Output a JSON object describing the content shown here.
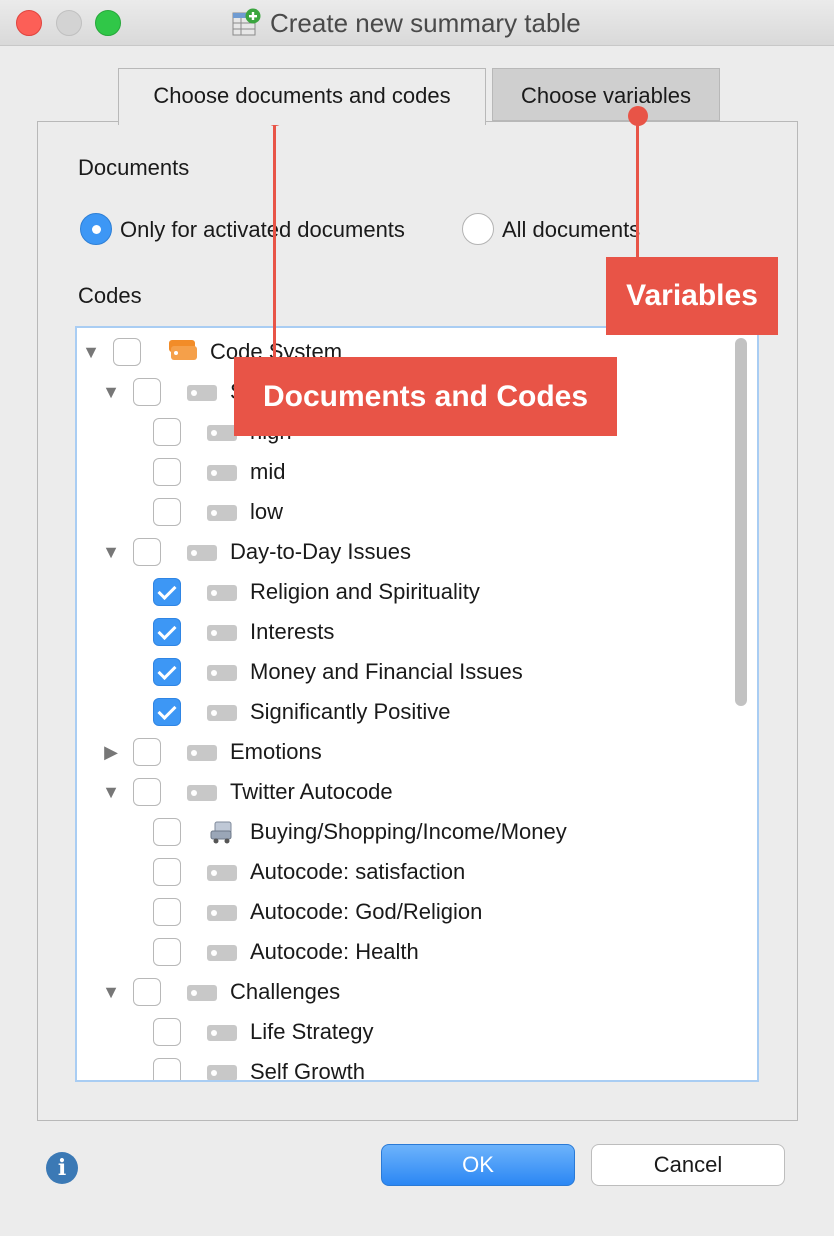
{
  "window": {
    "title": "Create new summary table"
  },
  "tabs": [
    {
      "label": "Choose documents and codes",
      "active": true
    },
    {
      "label": "Choose variables",
      "active": false
    }
  ],
  "documents": {
    "heading": "Documents",
    "options": [
      {
        "label": "Only for activated documents",
        "selected": true
      },
      {
        "label": "All documents",
        "selected": false
      }
    ]
  },
  "codes": {
    "heading": "Codes",
    "tree": [
      {
        "label": "Code System",
        "expanded": true,
        "checked": false,
        "icon": "code-system-icon"
      },
      {
        "label": "S",
        "expanded": true,
        "checked": false,
        "icon": "code-tag-icon"
      },
      {
        "label": "high",
        "checked": false,
        "icon": "code-tag-icon"
      },
      {
        "label": "mid",
        "checked": false,
        "icon": "code-tag-icon"
      },
      {
        "label": "low",
        "checked": false,
        "icon": "code-tag-icon"
      },
      {
        "label": "Day-to-Day Issues",
        "expanded": true,
        "checked": false,
        "icon": "code-tag-icon"
      },
      {
        "label": "Religion and Spirituality",
        "checked": true,
        "icon": "code-tag-icon"
      },
      {
        "label": "Interests",
        "checked": true,
        "icon": "code-tag-icon"
      },
      {
        "label": "Money and Financial Issues",
        "checked": true,
        "icon": "code-tag-icon"
      },
      {
        "label": "Significantly Positive",
        "checked": true,
        "icon": "code-tag-icon"
      },
      {
        "label": "Emotions",
        "expanded": false,
        "checked": false,
        "icon": "code-tag-icon"
      },
      {
        "label": "Twitter Autocode",
        "expanded": true,
        "checked": false,
        "icon": "code-tag-icon"
      },
      {
        "label": "Buying/Shopping/Income/Money",
        "checked": false,
        "icon": "shopping-cart-icon"
      },
      {
        "label": "Autocode: satisfaction",
        "checked": false,
        "icon": "code-tag-icon"
      },
      {
        "label": "Autocode: God/Religion",
        "checked": false,
        "icon": "code-tag-icon"
      },
      {
        "label": "Autocode: Health",
        "checked": false,
        "icon": "code-tag-icon"
      },
      {
        "label": "Challenges",
        "expanded": true,
        "checked": false,
        "icon": "code-tag-icon"
      },
      {
        "label": "Life Strategy",
        "checked": false,
        "icon": "code-tag-icon"
      },
      {
        "label": "Self Growth",
        "checked": false,
        "icon": "code-tag-icon"
      }
    ]
  },
  "callouts": {
    "variables": "Variables",
    "documents_and_codes": "Documents and Codes"
  },
  "buttons": {
    "ok": "OK",
    "cancel": "Cancel"
  },
  "colors": {
    "accent": "#3d97f5",
    "callout": "#e85447"
  }
}
